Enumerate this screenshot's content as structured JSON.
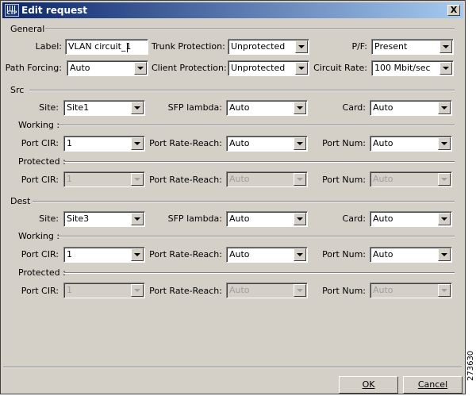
{
  "window": {
    "title": "Edit request",
    "app_icon_text": "CTP",
    "close_label": "X"
  },
  "general": {
    "heading": "General",
    "label": {
      "label": "Label:",
      "value": "VLAN circuit_1"
    },
    "trunk_protection": {
      "label": "Trunk Protection:",
      "value": "Unprotected"
    },
    "pf": {
      "label": "P/F:",
      "value": "Present"
    },
    "path_forcing": {
      "label": "Path Forcing:",
      "value": "Auto"
    },
    "client_protection": {
      "label": "Client Protection:",
      "value": "Unprotected"
    },
    "circuit_rate": {
      "label": "Circuit Rate:",
      "value": "100 Mbit/sec"
    }
  },
  "src": {
    "heading": "Src",
    "site": {
      "label": "Site:",
      "value": "Site1"
    },
    "sfp_lambda": {
      "label": "SFP lambda:",
      "value": "Auto"
    },
    "card": {
      "label": "Card:",
      "value": "Auto"
    },
    "working": {
      "heading": "Working :",
      "port_cir": {
        "label": "Port CIR:",
        "value": "1"
      },
      "port_rate_reach": {
        "label": "Port Rate-Reach:",
        "value": "Auto"
      },
      "port_num": {
        "label": "Port Num:",
        "value": "Auto"
      }
    },
    "protected": {
      "heading": "Protected :",
      "port_cir": {
        "label": "Port CIR:",
        "value": "1"
      },
      "port_rate_reach": {
        "label": "Port Rate-Reach:",
        "value": "Auto"
      },
      "port_num": {
        "label": "Port Num:",
        "value": "Auto"
      }
    }
  },
  "dest": {
    "heading": "Dest",
    "site": {
      "label": "Site:",
      "value": "Site3"
    },
    "sfp_lambda": {
      "label": "SFP lambda:",
      "value": "Auto"
    },
    "card": {
      "label": "Card:",
      "value": "Auto"
    },
    "working": {
      "heading": "Working :",
      "port_cir": {
        "label": "Port CIR:",
        "value": "1"
      },
      "port_rate_reach": {
        "label": "Port Rate-Reach:",
        "value": "Auto"
      },
      "port_num": {
        "label": "Port Num:",
        "value": "Auto"
      }
    },
    "protected": {
      "heading": "Protected :",
      "port_cir": {
        "label": "Port CIR:",
        "value": "1"
      },
      "port_rate_reach": {
        "label": "Port Rate-Reach:",
        "value": "Auto"
      },
      "port_num": {
        "label": "Port Num:",
        "value": "Auto"
      }
    }
  },
  "buttons": {
    "ok": "OK",
    "cancel": "Cancel"
  },
  "figure_id": "273630"
}
